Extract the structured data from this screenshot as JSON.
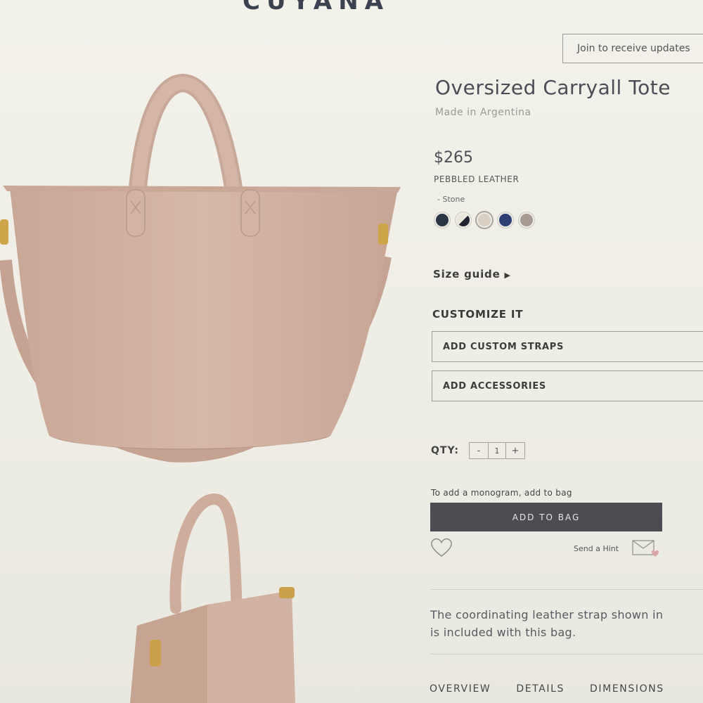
{
  "brand": "CUYANA",
  "join_button": "Join to receive updates",
  "product": {
    "title": "Oversized Carryall Tote",
    "origin": "Made in Argentina",
    "price": "$265",
    "material": "PEBBLED LEATHER",
    "color_label": "- Stone",
    "swatches": [
      {
        "color": "#2a3444"
      },
      {
        "color": "#1f2430",
        "accent": "#e9e6dd"
      },
      {
        "color": "#d9cfc3",
        "selected": true
      },
      {
        "color": "#2c3e74"
      },
      {
        "color": "#a59b92"
      }
    ]
  },
  "size_guide": "Size guide",
  "customize": {
    "heading": "CUSTOMIZE IT",
    "custom_straps": "ADD CUSTOM STRAPS",
    "accessories": "ADD ACCESSORIES"
  },
  "qty": {
    "label": "QTY:",
    "minus": "-",
    "value": "1",
    "plus": "+"
  },
  "monogram_note": "To add a monogram, add to bag",
  "add_to_bag": "ADD TO BAG",
  "send_hint": "Send a Hint",
  "description": {
    "line1": "The coordinating leather strap shown in",
    "line2": "is included with this bag."
  },
  "tabs": {
    "overview": "OVERVIEW",
    "details": "DETAILS",
    "dimensions": "DIMENSIONS"
  }
}
